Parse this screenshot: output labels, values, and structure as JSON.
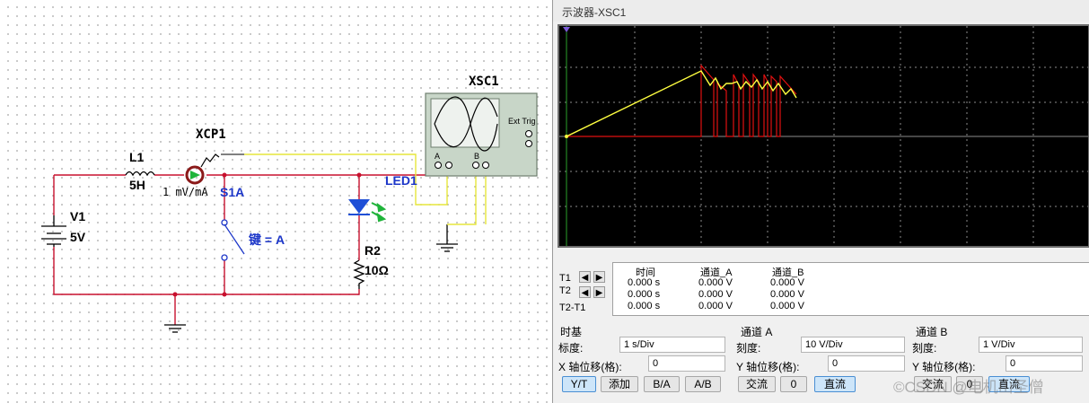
{
  "schematic": {
    "xsc1_label": "XSC1",
    "xcp1_label": "XCP1",
    "xcp1_value": "1 mV/mA",
    "l1_label": "L1",
    "l1_value": "5H",
    "v1_label": "V1",
    "v1_value": "5V",
    "s1_label": "S1A",
    "s1_key": "键 = A",
    "led_label": "LED1",
    "r2_label": "R2",
    "r2_value": "10Ω",
    "ext_trig": "Ext Trig",
    "terminal_a": "A",
    "terminal_b": "B",
    "plus": "+",
    "minus": "_",
    "colors": {
      "wire": "#c8102e",
      "probe_wire": "#e6e63c",
      "led": "#1f4fd6",
      "led_arrows": "#1fb43a"
    }
  },
  "scope": {
    "title": "示波器-XSC1",
    "trace_colors": {
      "channel_a": "#ffff40",
      "channel_b": "#e01010",
      "grid": "#9a9a9a"
    },
    "readout": {
      "headers": [
        "时间",
        "通道_A",
        "通道_B"
      ],
      "rows": [
        {
          "label": "T1",
          "time": "0.000 s",
          "a": "0.000 V",
          "b": "0.000 V"
        },
        {
          "label": "T2",
          "time": "0.000 s",
          "a": "0.000 V",
          "b": "0.000 V"
        },
        {
          "label": "T2-T1",
          "time": "0.000 s",
          "a": "0.000 V",
          "b": "0.000 V"
        }
      ],
      "arrow_left": "◀",
      "arrow_right": "▶"
    },
    "timebase": {
      "title": "时基",
      "scale_label": "标度:",
      "scale_value": "1 s/Div",
      "x_offset_label": "X 轴位移(格):",
      "x_offset_value": "0",
      "buttons": [
        "Y/T",
        "添加",
        "B/A",
        "A/B"
      ]
    },
    "channel_a": {
      "title": "通道 A",
      "scale_label": "刻度:",
      "scale_value": "10  V/Div",
      "y_offset_label": "Y 轴位移(格):",
      "y_offset_value": "0",
      "coupling": [
        "交流",
        "0",
        "直流"
      ]
    },
    "channel_b": {
      "title": "通道 B",
      "scale_label": "刻度:",
      "scale_value": "1  V/Div",
      "y_offset_label": "Y 轴位移(格):",
      "y_offset_value": "0",
      "coupling": [
        "交流",
        "0",
        "直流"
      ]
    }
  },
  "watermark": "©CSDN @电机山圣僧"
}
